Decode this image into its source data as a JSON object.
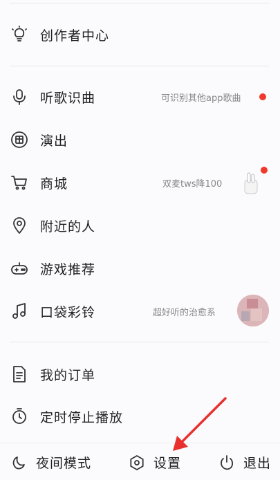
{
  "menu": {
    "creator_center": "创作者中心",
    "listen_song": "听歌识曲",
    "listen_hint": "可识别其他app歌曲",
    "shows": "演出",
    "mall": "商城",
    "mall_hint": "双麦tws降100",
    "nearby": "附近的人",
    "games": "游戏推荐",
    "ringtone": "口袋彩铃",
    "ringtone_hint": "超好听的治愈系",
    "my_orders": "我的订单",
    "timer_stop": "定时停止播放"
  },
  "bottom_bar": {
    "night_mode": "夜间模式",
    "settings": "设置",
    "exit": "退出"
  },
  "colors": {
    "badge": "#f0392b",
    "arrow": "#e8312f"
  }
}
